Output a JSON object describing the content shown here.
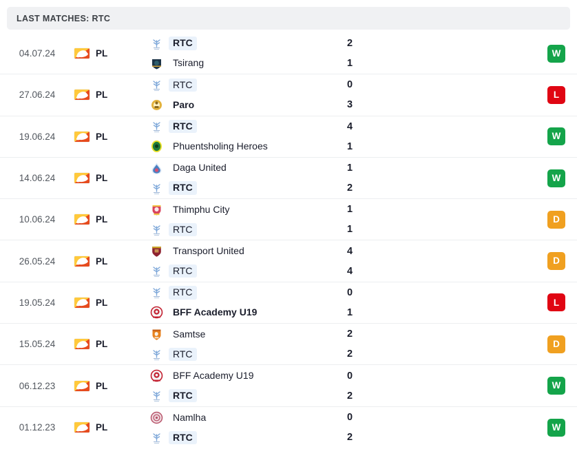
{
  "header": {
    "title": "LAST MATCHES: RTC"
  },
  "team_focus": "RTC",
  "colors": {
    "win": "#14a44a",
    "loss": "#e00613",
    "draw": "#f0a020",
    "highlight": "#eaf2fb",
    "header_bg": "#f0f1f3",
    "row_divider": "#eceef0"
  },
  "crests": {
    "RTC": {
      "name": "rtc-crest",
      "primary": "#7da7d9",
      "secondary": "#4a79b5"
    },
    "Tsirang": {
      "name": "tsirang-crest",
      "primary": "#1d3448",
      "secondary": "#d4a437"
    },
    "Paro": {
      "name": "paro-crest",
      "primary": "#e3b23c",
      "secondary": "#8a6a1f"
    },
    "Phuentsholing Heroes": {
      "name": "phuentsholing-heroes-crest",
      "primary": "#1f7a3a",
      "secondary": "#e8e02a"
    },
    "Daga United": {
      "name": "daga-united-crest",
      "primary": "#4a7fc1",
      "secondary": "#d94f70"
    },
    "Thimphu City": {
      "name": "thimphu-city-crest",
      "primary": "#d9455f",
      "secondary": "#f0c244"
    },
    "Transport United": {
      "name": "transport-united-crest",
      "primary": "#8e2230",
      "secondary": "#c9a227"
    },
    "BFF Academy U19": {
      "name": "bff-academy-u19-crest",
      "primary": "#c32030",
      "secondary": "#f2f2f2"
    },
    "Samtse": {
      "name": "samtse-crest",
      "primary": "#e8821e",
      "secondary": "#f7f2e8"
    },
    "Namlha": {
      "name": "namlha-crest",
      "primary": "#b8556b",
      "secondary": "#f0dde2"
    }
  },
  "matches": [
    {
      "date": "04.07.24",
      "league": {
        "code": "PL",
        "flag": "bhutan-flag"
      },
      "home": {
        "name": "RTC",
        "score": "2",
        "is_focus": true,
        "bold": true
      },
      "away": {
        "name": "Tsirang",
        "score": "1",
        "is_focus": false,
        "bold": false
      },
      "result": "W"
    },
    {
      "date": "27.06.24",
      "league": {
        "code": "PL",
        "flag": "bhutan-flag"
      },
      "home": {
        "name": "RTC",
        "score": "0",
        "is_focus": true,
        "bold": false
      },
      "away": {
        "name": "Paro",
        "score": "3",
        "is_focus": false,
        "bold": true
      },
      "result": "L"
    },
    {
      "date": "19.06.24",
      "league": {
        "code": "PL",
        "flag": "bhutan-flag"
      },
      "home": {
        "name": "RTC",
        "score": "4",
        "is_focus": true,
        "bold": true
      },
      "away": {
        "name": "Phuentsholing Heroes",
        "score": "1",
        "is_focus": false,
        "bold": false
      },
      "result": "W"
    },
    {
      "date": "14.06.24",
      "league": {
        "code": "PL",
        "flag": "bhutan-flag"
      },
      "home": {
        "name": "Daga United",
        "score": "1",
        "is_focus": false,
        "bold": false
      },
      "away": {
        "name": "RTC",
        "score": "2",
        "is_focus": true,
        "bold": true
      },
      "result": "W"
    },
    {
      "date": "10.06.24",
      "league": {
        "code": "PL",
        "flag": "bhutan-flag"
      },
      "home": {
        "name": "Thimphu City",
        "score": "1",
        "is_focus": false,
        "bold": false
      },
      "away": {
        "name": "RTC",
        "score": "1",
        "is_focus": true,
        "bold": false
      },
      "result": "D"
    },
    {
      "date": "26.05.24",
      "league": {
        "code": "PL",
        "flag": "bhutan-flag"
      },
      "home": {
        "name": "Transport United",
        "score": "4",
        "is_focus": false,
        "bold": false
      },
      "away": {
        "name": "RTC",
        "score": "4",
        "is_focus": true,
        "bold": false
      },
      "result": "D"
    },
    {
      "date": "19.05.24",
      "league": {
        "code": "PL",
        "flag": "bhutan-flag"
      },
      "home": {
        "name": "RTC",
        "score": "0",
        "is_focus": true,
        "bold": false
      },
      "away": {
        "name": "BFF Academy U19",
        "score": "1",
        "is_focus": false,
        "bold": true
      },
      "result": "L"
    },
    {
      "date": "15.05.24",
      "league": {
        "code": "PL",
        "flag": "bhutan-flag"
      },
      "home": {
        "name": "Samtse",
        "score": "2",
        "is_focus": false,
        "bold": false
      },
      "away": {
        "name": "RTC",
        "score": "2",
        "is_focus": true,
        "bold": false
      },
      "result": "D"
    },
    {
      "date": "06.12.23",
      "league": {
        "code": "PL",
        "flag": "bhutan-flag"
      },
      "home": {
        "name": "BFF Academy U19",
        "score": "0",
        "is_focus": false,
        "bold": false
      },
      "away": {
        "name": "RTC",
        "score": "2",
        "is_focus": true,
        "bold": true
      },
      "result": "W"
    },
    {
      "date": "01.12.23",
      "league": {
        "code": "PL",
        "flag": "bhutan-flag"
      },
      "home": {
        "name": "Namlha",
        "score": "0",
        "is_focus": false,
        "bold": false
      },
      "away": {
        "name": "RTC",
        "score": "2",
        "is_focus": true,
        "bold": true
      },
      "result": "W"
    }
  ]
}
